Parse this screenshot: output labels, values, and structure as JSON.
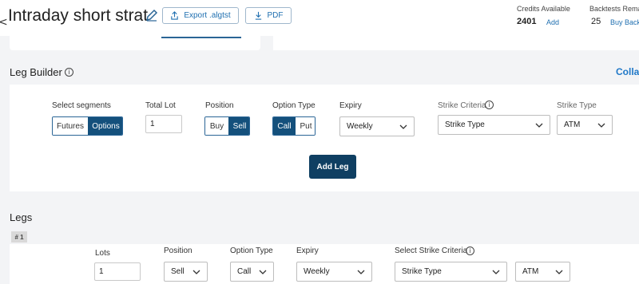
{
  "header": {
    "back_glyph": "<",
    "title": "Intraday short strat",
    "edit_icon": "pencil-icon",
    "export_label": "Export .algtst",
    "export_icon": "share-icon",
    "pdf_label": "PDF",
    "pdf_icon": "download-icon",
    "credits_label": "Credits Available",
    "credits_value": "2401",
    "credits_add": "Add",
    "backtests_label": "Backtests Rema",
    "backtests_value": "25",
    "backtests_action": "Buy Back"
  },
  "leg_builder": {
    "title": "Leg Builder",
    "info_icon": "info-icon",
    "collapse_label": "Colla",
    "segments": {
      "label": "Select segments",
      "options": [
        "Futures",
        "Options"
      ],
      "selected": "Options"
    },
    "total_lot": {
      "label": "Total Lot",
      "value": "1"
    },
    "position": {
      "label": "Position",
      "options": [
        "Buy",
        "Sell"
      ],
      "selected": "Sell"
    },
    "option_type": {
      "label": "Option Type",
      "options": [
        "Call",
        "Put"
      ],
      "selected": "Call"
    },
    "expiry": {
      "label": "Expiry",
      "value": "Weekly"
    },
    "strike_criteria": {
      "label": "Strike Criteria",
      "value": "Strike Type"
    },
    "strike_type": {
      "label": "Strike Type",
      "value": "ATM"
    },
    "add_leg_label": "Add Leg"
  },
  "legs": {
    "title": "Legs",
    "items": [
      {
        "badge": "# 1",
        "lots": {
          "label": "Lots",
          "value": "1"
        },
        "position": {
          "label": "Position",
          "value": "Sell"
        },
        "option_type": {
          "label": "Option Type",
          "value": "Call"
        },
        "expiry": {
          "label": "Expiry",
          "value": "Weekly"
        },
        "strike_criteria": {
          "label": "Select Strike Criteria",
          "value": "Strike Type"
        },
        "strike_type": {
          "value": "ATM"
        }
      }
    ]
  },
  "colors": {
    "accent": "#14507c",
    "button_dark": "#0f3f62",
    "link": "#1f78c8"
  }
}
